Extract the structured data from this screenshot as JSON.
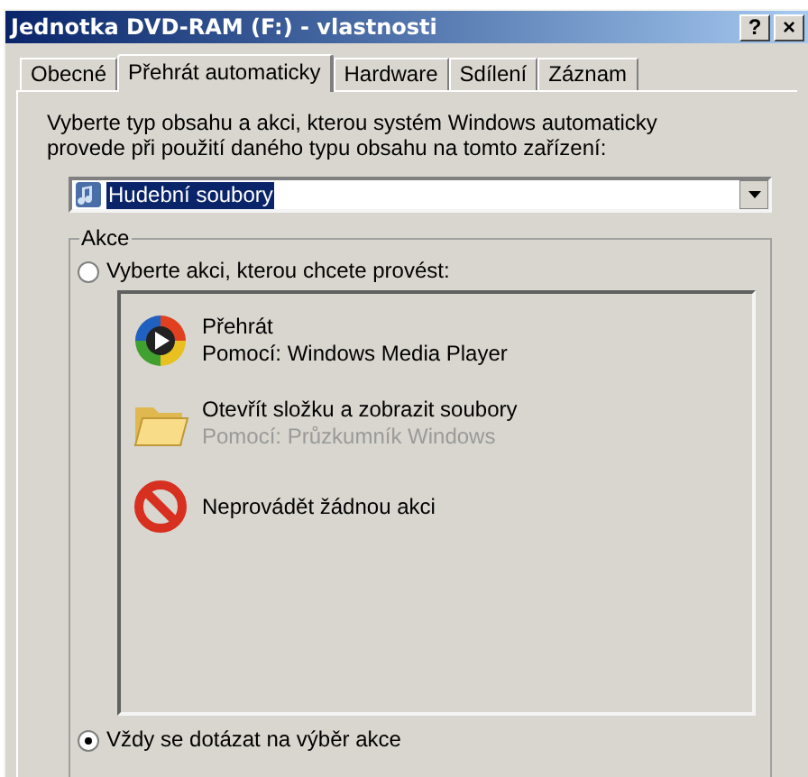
{
  "window": {
    "title": "Jednotka DVD-RAM (F:) - vlastnosti",
    "title_buttons": [
      "?",
      "×"
    ]
  },
  "tabs": [
    {
      "label": "Obecné",
      "selected": false
    },
    {
      "label": "Přehrát automaticky",
      "selected": true
    },
    {
      "label": "Hardware",
      "selected": false
    },
    {
      "label": "Sdílení",
      "selected": false
    },
    {
      "label": "Záznam",
      "selected": false
    }
  ],
  "instructions": "Vyberte typ obsahu a akci, kterou systém Windows automaticky provede při použití daného typu obsahu na tomto zařízení:",
  "content_type": {
    "value": "Hudební soubory"
  },
  "actions_group": {
    "title": "Akce",
    "choose_option": {
      "label": "Vyberte akci, kterou chcete provést:",
      "selected": false
    },
    "actions": [
      {
        "kind": "player",
        "title": "Přehrát",
        "subtitle": "Pomocí: Windows Media Player",
        "disabled": false
      },
      {
        "kind": "folder",
        "title": "Otevřít složku a zobrazit soubory",
        "subtitle": "Pomocí: Průzkumník Windows",
        "disabled": true
      },
      {
        "kind": "none",
        "title": "Neprovádět žádnou akci",
        "disabled": false
      }
    ],
    "ask_option": {
      "label": "Vždy se dotázat na výběr akce",
      "selected": true
    }
  }
}
